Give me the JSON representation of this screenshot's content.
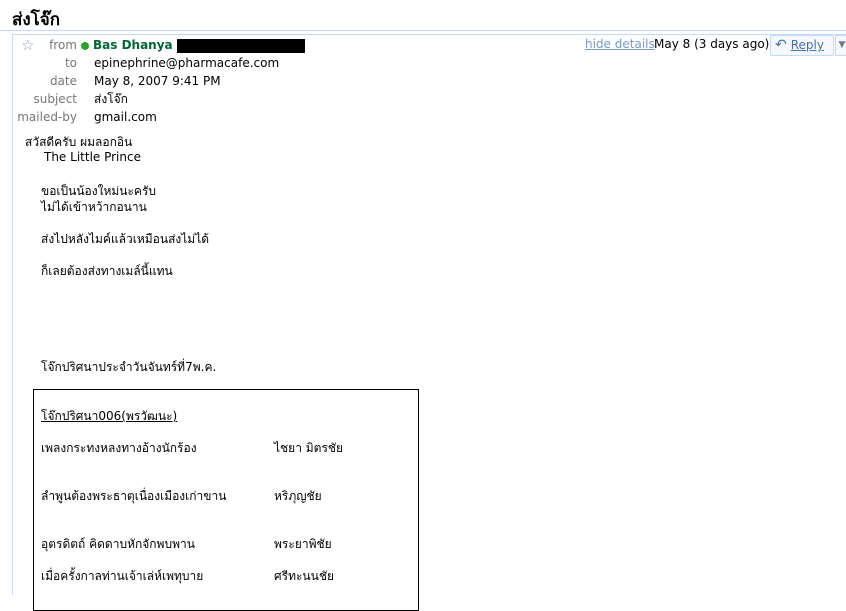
{
  "page_title": "ส่งโจ๊ก",
  "header": {
    "from_label": "from",
    "from_name": "Bas Dhanya",
    "to_label": "to",
    "to_value": "epinephrine@pharmacafe.com",
    "date_label": "date",
    "date_value": "May 8, 2007 9:41 PM",
    "subject_label": "subject",
    "subject_value": "ส่งโจ๊ก",
    "mailedby_label": "mailed-by",
    "mailedby_value": "gmail.com",
    "hide_details": "hide details",
    "date_short": "May 8 (3 days ago)",
    "reply_label": "Reply"
  },
  "body": {
    "lines": [
      "สวัสดีครับ ผมลอกอิน",
      "The Little Prince",
      "ขอเป็นน้องใหม่นะครับ",
      "ไม่ได้เข้าหว้ากอนาน",
      "ส่งไปหลังไมค์แล้วเหมือนส่งไม่ได้",
      "ก็เลยต้องส่งทางเมล์นี้แทน",
      "โจ๊กปริศนาประจำวันจันทร์ที่7พ.ค."
    ]
  },
  "table": {
    "caption": "โจ๊กปริศนา006(พรวัฒนะ)",
    "rows": [
      {
        "clue": "เพลงกระทงหลงทางอ้างนักร้อง",
        "answer": "ไชยา มิตรชัย"
      },
      {
        "clue": "ลำพูนต้องพระธาตุเนื่องเมืองเก่าขาน",
        "answer": "หริภุญชัย"
      },
      {
        "clue": "อุตรดิตถ์ คิดดาบหักจักพบพาน",
        "answer": "พระยาพิชัย"
      },
      {
        "clue": "เมื่อครั้งกาลท่านเจ้าเล่ห์เพทุบาย",
        "answer": "ศรีทะนนชัย"
      }
    ]
  },
  "colors": {
    "border": "#c3d9ff",
    "sender": "#006633",
    "link": "#7a9bc6",
    "online_dot": "#2da12d"
  }
}
